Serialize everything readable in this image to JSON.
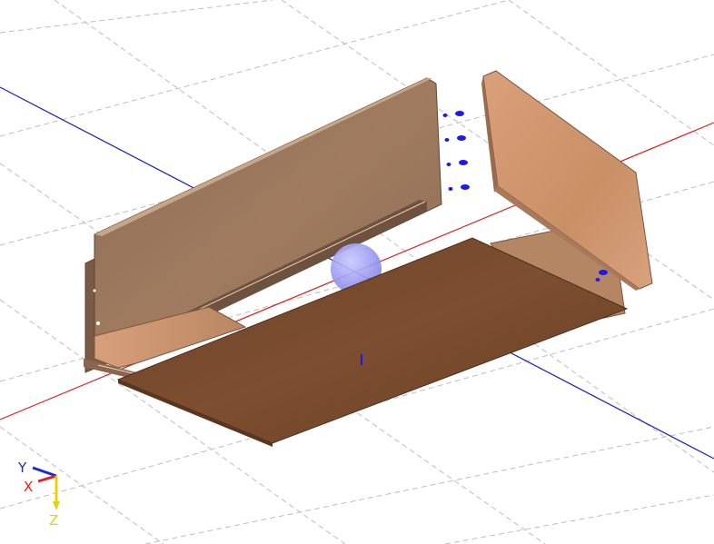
{
  "viewport": {
    "background_color": "#ffffff",
    "grid_color": "#bdbdbd",
    "axis_colors": {
      "red_line": "#e02020",
      "blue_line": "#1a1acc"
    }
  },
  "model": {
    "parts": [
      {
        "name": "side-panel-left",
        "color": "#9c7a5e"
      },
      {
        "name": "end-panel-front",
        "color": "#d59b73"
      },
      {
        "name": "bottom-panel",
        "color": "#7a4a2c"
      },
      {
        "name": "end-panel-back",
        "color": "#c88f69"
      },
      {
        "name": "pivot-sphere",
        "color": "#8e8ef0"
      },
      {
        "name": "dowel-markers",
        "color": "#1a1aee"
      }
    ]
  },
  "orientation_gizmo": {
    "y_label": "Y",
    "x_label": "X",
    "z_label": "Z",
    "y_color": "#1a2bd6",
    "x_color": "#e02020",
    "z_color": "#e8d010"
  }
}
